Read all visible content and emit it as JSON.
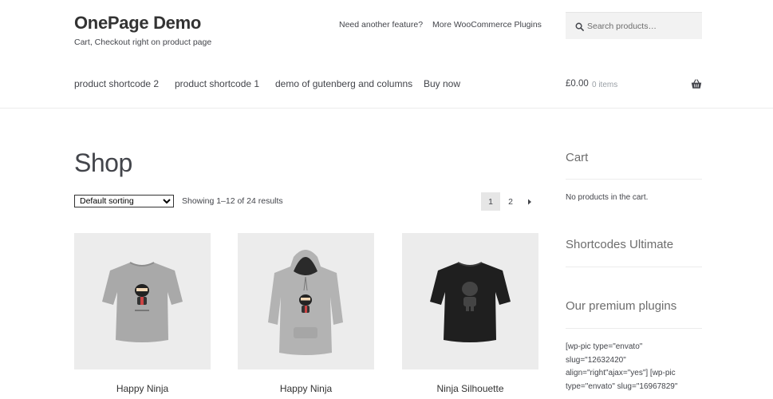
{
  "site": {
    "title": "OnePage Demo",
    "tagline": "Cart, Checkout right on product page"
  },
  "top_links": [
    "Need another feature?",
    "More WooCommerce Plugins"
  ],
  "search": {
    "placeholder": "Search products…"
  },
  "nav": [
    "product shortcode 2",
    "product shortcode 1",
    "demo of gutenberg and columns",
    "Buy now"
  ],
  "header_cart": {
    "total": "£0.00",
    "items": "0 items"
  },
  "page": {
    "title": "Shop"
  },
  "toolbar": {
    "sort_selected": "Default sorting",
    "result_count": "Showing 1–12 of 24 results",
    "pages": [
      "1",
      "2"
    ],
    "next_label": "›"
  },
  "products": [
    {
      "title": "Happy Ninja",
      "kind": "t-shirt-grey"
    },
    {
      "title": "Happy Ninja",
      "kind": "hoodie-grey"
    },
    {
      "title": "Ninja Silhouette",
      "kind": "t-shirt-black"
    }
  ],
  "sidebar": {
    "cart_title": "Cart",
    "cart_empty": "No products in the cart.",
    "shortcodes_title": "Shortcodes Ultimate",
    "premium_title": "Our premium plugins",
    "premium_code_lines": [
      "[wp-pic type=\"envato\"",
      "slug=\"12632420\"",
      "align=\"right\"ajax=\"yes\"] [wp-pic",
      "type=\"envato\" slug=\"16967829\""
    ]
  },
  "colors": {
    "text": "#43454b",
    "image_bg": "#ececec",
    "search_bg": "#f2f2f2"
  }
}
